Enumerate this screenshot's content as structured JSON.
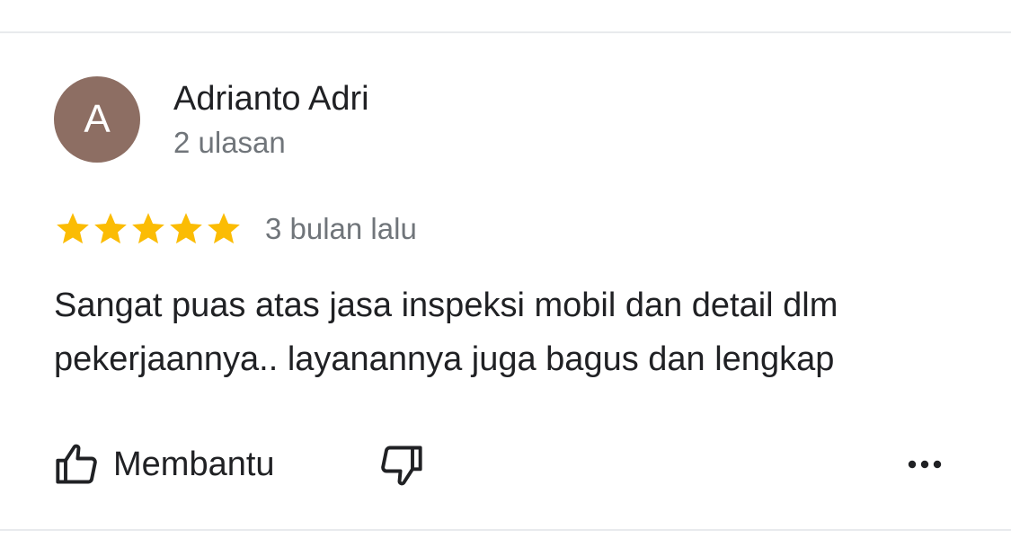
{
  "review": {
    "avatar_letter": "A",
    "avatar_color": "#8d6e63",
    "author_name": "Adrianto Adri",
    "review_count": "2 ulasan",
    "rating": 5,
    "rating_max": 5,
    "star_color": "#fbbc04",
    "time_ago": "3 bulan lalu",
    "text": "Sangat puas atas jasa inspeksi mobil dan detail dlm pekerjaannya.. layanannya juga bagus dan lengkap"
  },
  "actions": {
    "helpful_label": "Membantu",
    "helpful_icon": "thumb-up-outline-icon",
    "not_helpful_icon": "thumb-down-outline-icon",
    "more_icon": "more-horizontal-icon"
  }
}
